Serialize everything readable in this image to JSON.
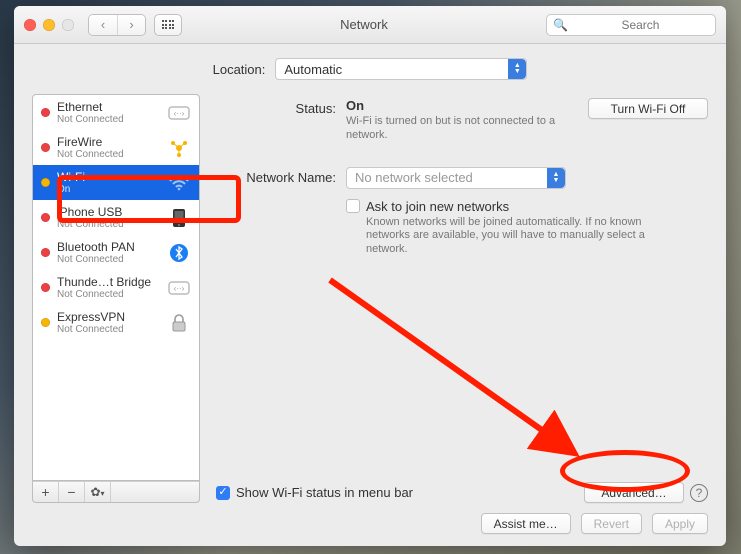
{
  "window": {
    "title": "Network"
  },
  "toolbar": {
    "search_placeholder": "Search"
  },
  "location": {
    "label": "Location:",
    "selected": "Automatic"
  },
  "sidebar": {
    "items": [
      {
        "name": "Ethernet",
        "sub": "Not Connected",
        "status": "red",
        "icon": "ethernet"
      },
      {
        "name": "FireWire",
        "sub": "Not Connected",
        "status": "red",
        "icon": "firewire"
      },
      {
        "name": "Wi-Fi",
        "sub": "On",
        "status": "amber",
        "icon": "wifi",
        "selected": true
      },
      {
        "name": "iPhone USB",
        "sub": "Not Connected",
        "status": "red",
        "icon": "iphone"
      },
      {
        "name": "Bluetooth PAN",
        "sub": "Not Connected",
        "status": "red",
        "icon": "bluetooth"
      },
      {
        "name": "Thunde…t Bridge",
        "sub": "Not Connected",
        "status": "red",
        "icon": "ethernet"
      },
      {
        "name": "ExpressVPN",
        "sub": "Not Connected",
        "status": "amber",
        "icon": "lock"
      }
    ]
  },
  "detail": {
    "status_label": "Status:",
    "status_value": "On",
    "wifi_off_btn": "Turn Wi-Fi Off",
    "status_desc": "Wi-Fi is turned on but is not connected to a network.",
    "netname_label": "Network Name:",
    "netname_selected": "No network selected",
    "ask_join": "Ask to join new networks",
    "ask_join_desc": "Known networks will be joined automatically. If no known networks are available, you will have to manually select a network.",
    "show_status": "Show Wi-Fi status in menu bar",
    "advanced_btn": "Advanced…"
  },
  "footer": {
    "assist": "Assist me…",
    "revert": "Revert",
    "apply": "Apply"
  }
}
